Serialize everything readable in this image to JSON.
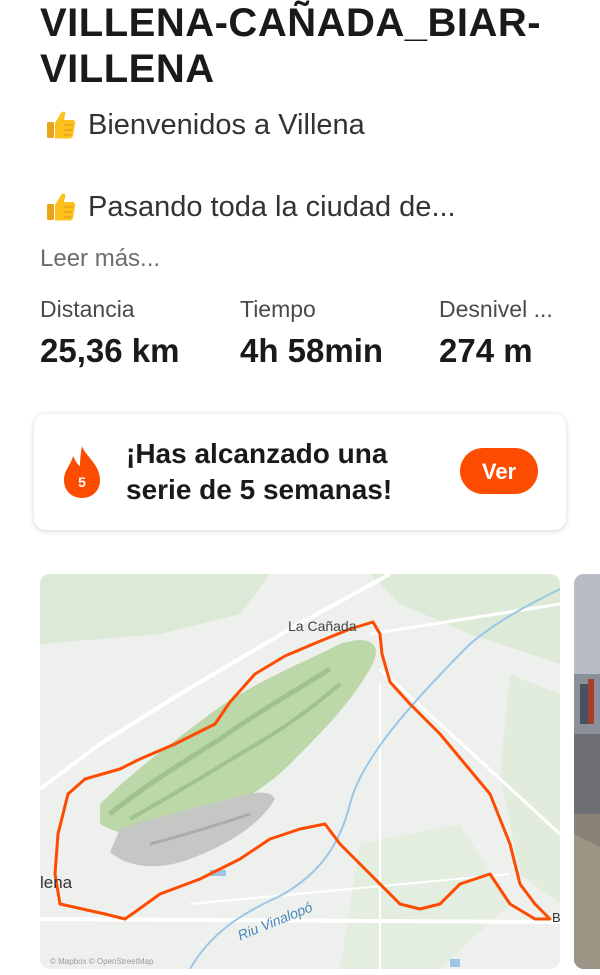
{
  "activity": {
    "title": "VILLENA-CAÑADA_BIAR-VILLENA",
    "description_lines": [
      "Bienvenidos a Villena",
      "Pasando toda la ciudad de..."
    ],
    "read_more": "Leer más..."
  },
  "stats": [
    {
      "label": "Distancia",
      "value": "25,36 km"
    },
    {
      "label": "Tiempo",
      "value": "4h 58min"
    },
    {
      "label": "Desnivel ...",
      "value": "274 m"
    }
  ],
  "streak_card": {
    "badge_number": "5",
    "message": "¡Has alcanzado una serie de 5 semanas!",
    "button_label": "Ver"
  },
  "map": {
    "place_labels": [
      "La Cañada",
      "lena",
      "Riu Vinalopó",
      "B"
    ],
    "attribution": "© Mapbox © OpenStreetMap",
    "route_color": "#fc4c02"
  },
  "colors": {
    "accent": "#fc4c02",
    "text": "#1a1a1a",
    "muted": "#6d6d6d"
  },
  "icons": {
    "description_emoji": "thumbs-up-icon",
    "streak_icon": "flame-icon"
  }
}
